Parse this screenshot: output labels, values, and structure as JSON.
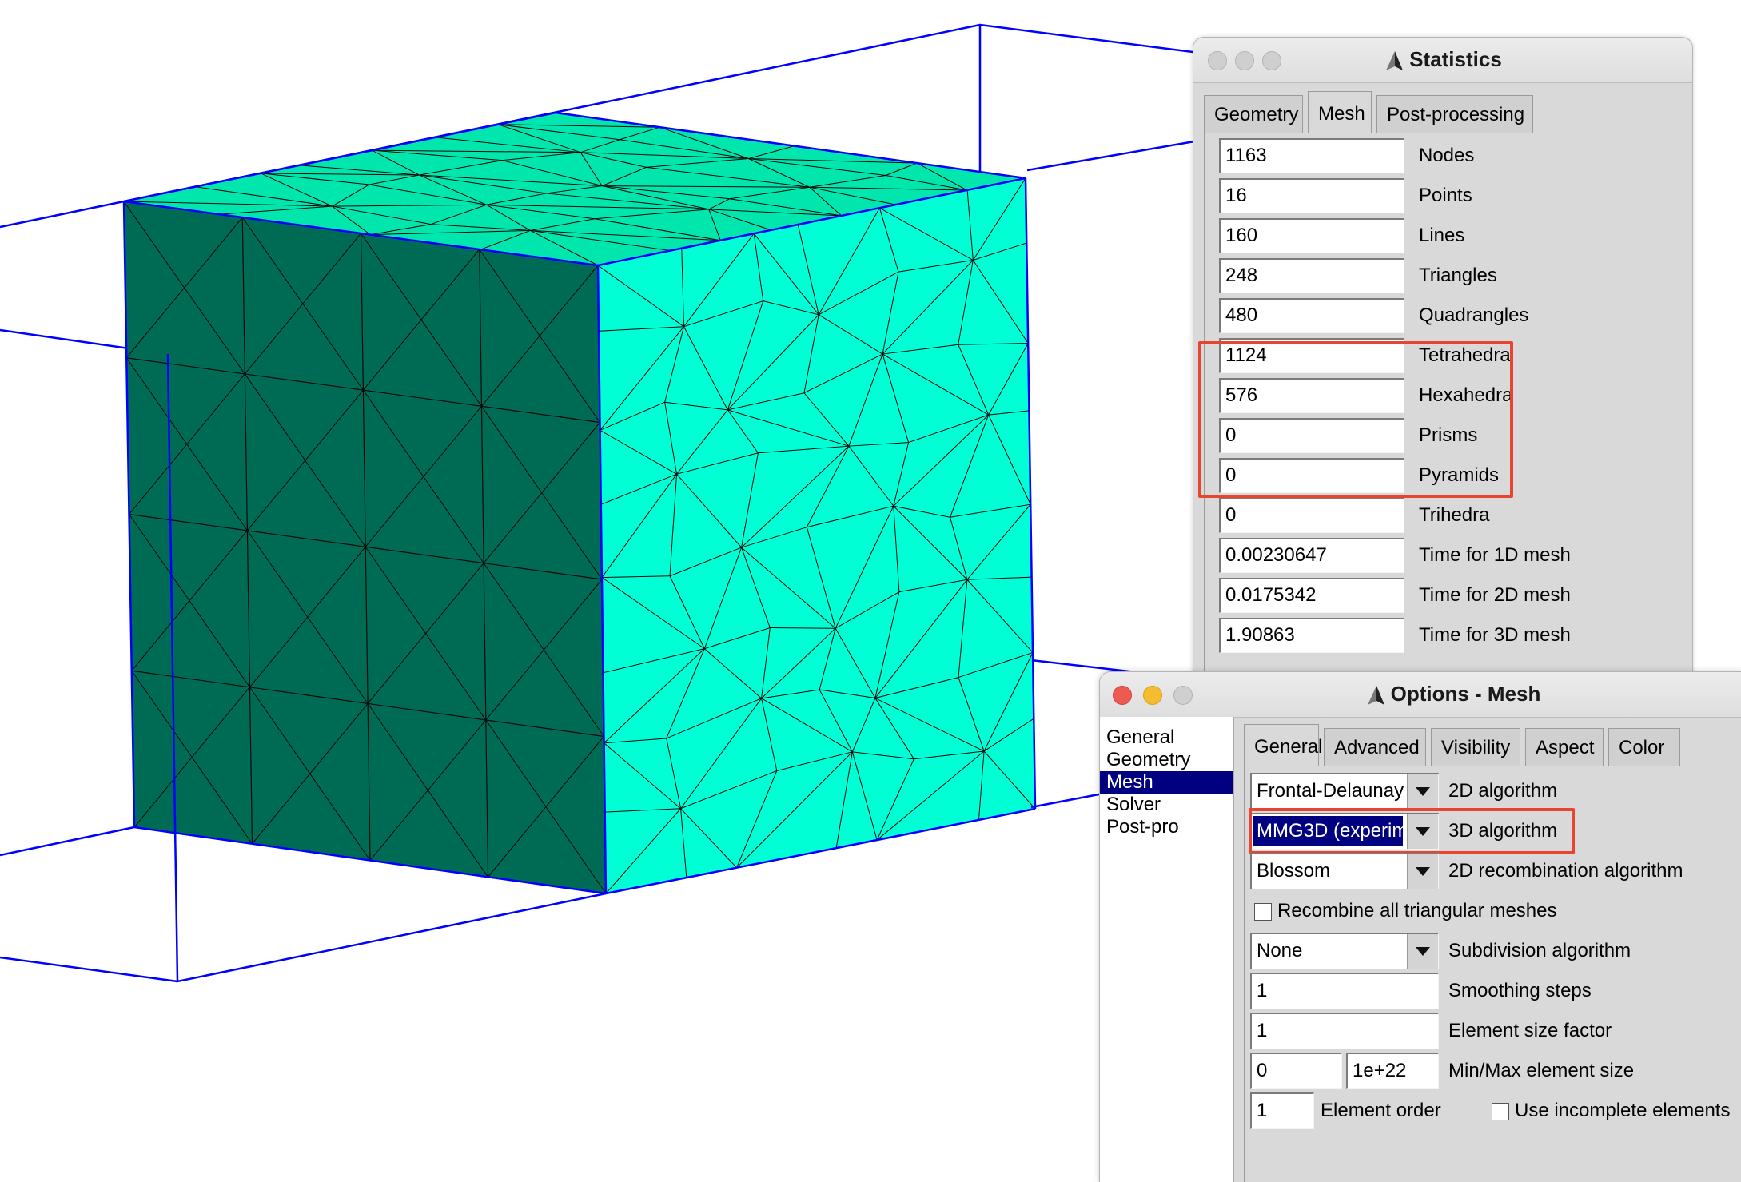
{
  "statistics_window": {
    "title": "Statistics",
    "tabs": [
      "Geometry",
      "Mesh",
      "Post-processing"
    ],
    "active_tab": "Mesh",
    "rows": [
      {
        "value": "1163",
        "label": "Nodes"
      },
      {
        "value": "16",
        "label": "Points"
      },
      {
        "value": "160",
        "label": "Lines"
      },
      {
        "value": "248",
        "label": "Triangles"
      },
      {
        "value": "480",
        "label": "Quadrangles"
      },
      {
        "value": "1124",
        "label": "Tetrahedra"
      },
      {
        "value": "576",
        "label": "Hexahedra"
      },
      {
        "value": "0",
        "label": "Prisms"
      },
      {
        "value": "0",
        "label": "Pyramids"
      },
      {
        "value": "0",
        "label": "Trihedra"
      },
      {
        "value": "0.00230647",
        "label": "Time for 1D mesh"
      },
      {
        "value": "0.0175342",
        "label": "Time for 2D mesh"
      },
      {
        "value": "1.90863",
        "label": "Time for 3D mesh"
      }
    ]
  },
  "options_window": {
    "title": "Options - Mesh",
    "browser_items": [
      "General",
      "Geometry",
      "Mesh",
      "Solver",
      "Post-pro"
    ],
    "selected_browser_item": "Mesh",
    "tabs": [
      "General",
      "Advanced",
      "Visibility",
      "Aspect",
      "Color"
    ],
    "active_tab": "General",
    "algorithm_2d": {
      "value": "Frontal-Delaunay",
      "label": "2D algorithm"
    },
    "algorithm_3d": {
      "value": "MMG3D (experim",
      "label": "3D algorithm"
    },
    "recombination_2d": {
      "value": "Blossom",
      "label": "2D recombination algorithm"
    },
    "recombine_all": {
      "label": "Recombine all triangular meshes",
      "checked": false
    },
    "subdivision": {
      "value": "None",
      "label": "Subdivision algorithm"
    },
    "smoothing_steps": {
      "value": "1",
      "label": "Smoothing steps"
    },
    "element_size_factor": {
      "value": "1",
      "label": "Element size factor"
    },
    "min_max_element_size": {
      "min": "0",
      "max": "1e+22",
      "label": "Min/Max element size"
    },
    "element_order": {
      "value": "1",
      "label": "Element order"
    },
    "incomplete_elements": {
      "label": "Use incomplete elements",
      "checked": false
    }
  },
  "colors": {
    "highlight": "#e8442f",
    "mesh_dark_face": "#006b54",
    "mesh_light_face": "#00ffd5",
    "mesh_top_face": "#00e6ad",
    "bounding_box": "#0000ff",
    "selection": "#000080"
  }
}
